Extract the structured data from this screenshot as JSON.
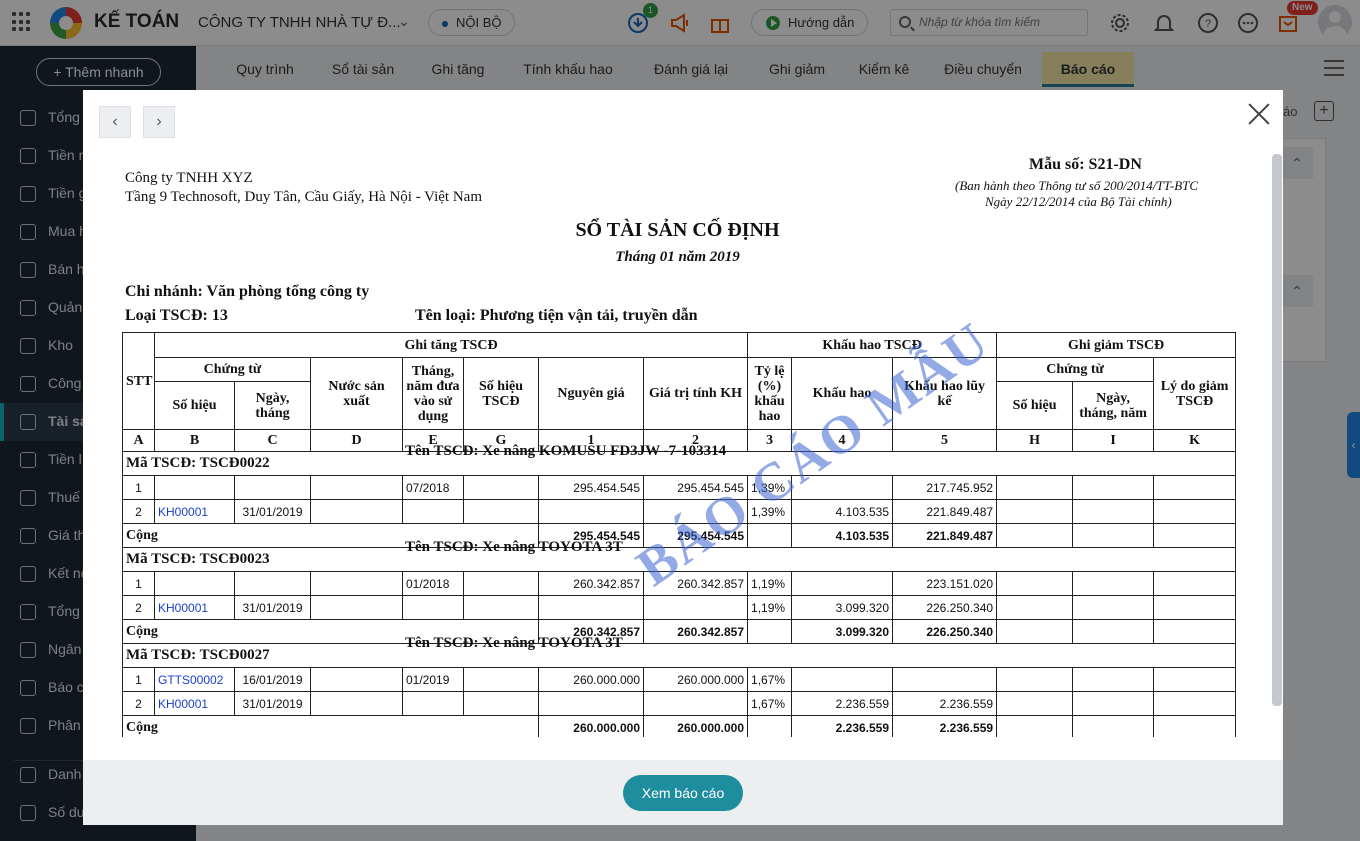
{
  "topbar": {
    "app_name": "KẾ TOÁN",
    "company": "CÔNG TY TNHH NHÀ TỰ Đ...",
    "scope": "NỘI BỘ",
    "download_badge": "1",
    "guide_label": "Hướng dẫn",
    "search_placeholder": "Nhập từ khóa tìm kiếm",
    "new_badge": "New"
  },
  "sidebar": {
    "add_button": "Thêm nhanh",
    "items": [
      {
        "label": "Tổng"
      },
      {
        "label": "Tiền m"
      },
      {
        "label": "Tiền g"
      },
      {
        "label": "Mua h"
      },
      {
        "label": "Bán h"
      },
      {
        "label": "Quản"
      },
      {
        "label": "Kho"
      },
      {
        "label": "Công"
      },
      {
        "label": "Tài sả"
      },
      {
        "label": "Tiền l"
      },
      {
        "label": "Thuế"
      },
      {
        "label": "Giá th"
      },
      {
        "label": "Kết nố"
      },
      {
        "label": "Tổng"
      },
      {
        "label": "Ngân"
      },
      {
        "label": "Báo c"
      },
      {
        "label": "Phân"
      },
      {
        "label": "Danh"
      },
      {
        "label": "Số dư"
      }
    ],
    "active_index": 8
  },
  "tabs": [
    {
      "label": "Quy trình"
    },
    {
      "label": "Sổ tài sản"
    },
    {
      "label": "Ghi tăng"
    },
    {
      "label": "Tính khấu hao"
    },
    {
      "label": "Đánh giá lại"
    },
    {
      "label": "Ghi giảm"
    },
    {
      "label": "Kiểm kê"
    },
    {
      "label": "Điều chuyển"
    },
    {
      "label": "Báo cáo"
    }
  ],
  "background": {
    "partial_text": "áo"
  },
  "report": {
    "company_name": "Công ty TNHH XYZ",
    "company_address": "Tầng 9 Technosoft, Duy Tân, Cầu Giấy, Hà Nội - Việt Nam",
    "form_no": "Mẫu số: S21-DN",
    "form_note_1": "(Ban hành theo Thông tư số 200/2014/TT-BTC",
    "form_note_2": "Ngày 22/12/2014 của Bộ Tài chính)",
    "title": "SỔ TÀI SẢN CỐ ĐỊNH",
    "period": "Tháng 01 năm 2019",
    "branch": "Chi nhánh: Văn phòng tổng công ty",
    "asset_type": "Loại TSCĐ: 13",
    "type_name": "Tên loại: Phương tiện vận tải, truyền dẫn",
    "watermark": "BÁO CÁO MẪU",
    "headers": {
      "stt": "STT",
      "increase": "Ghi tăng TSCĐ",
      "depreciation": "Khấu hao TSCĐ",
      "decrease": "Ghi giảm TSCĐ",
      "voucher": "Chứng từ",
      "voucher2": "Chứng từ",
      "voucher_no": "Số hiệu",
      "voucher_date": "Ngày, tháng",
      "country": "Nước sản xuất",
      "in_use": "Tháng, năm đưa vào sử dụng",
      "asset_no": "Số hiệu TSCĐ",
      "cost": "Nguyên giá",
      "depr_value": "Giá trị tính KH",
      "rate": "Tỷ lệ (%) khấu hao",
      "depr_amount": "Khấu hao",
      "accum_depr": "Khấu hao lũy kế",
      "dec_no": "Số hiệu",
      "dec_date": "Ngày, tháng, năm",
      "dec_reason": "Lý do giảm TSCĐ"
    },
    "letters": [
      "A",
      "B",
      "C",
      "D",
      "E",
      "G",
      "1",
      "2",
      "3",
      "4",
      "5",
      "H",
      "I",
      "K"
    ],
    "groups": [
      {
        "code": "Mã TSCĐ: TSCĐ0022",
        "name": "Tên TSCĐ: Xe nâng KOMUSU FD3JW -7-103314",
        "rows": [
          {
            "stt": "1",
            "voucher_no": "",
            "voucher_date": "",
            "in_use": "07/2018",
            "cost": "295.454.545",
            "depr_value": "295.454.545",
            "rate": "1,39%",
            "depr_amount": "",
            "accum": "217.745.952"
          },
          {
            "stt": "2",
            "voucher_no": "KH00001",
            "voucher_date": "31/01/2019",
            "in_use": "",
            "cost": "",
            "depr_value": "",
            "rate": "1,39%",
            "depr_amount": "4.103.535",
            "accum": "221.849.487"
          }
        ],
        "total": {
          "label": "Cộng",
          "cost": "295.454.545",
          "depr_value": "295.454.545",
          "depr_amount": "4.103.535",
          "accum": "221.849.487"
        }
      },
      {
        "code": "Mã TSCĐ: TSCĐ0023",
        "name": "Tên TSCĐ: Xe nâng TOYOTA 3T",
        "rows": [
          {
            "stt": "1",
            "voucher_no": "",
            "voucher_date": "",
            "in_use": "01/2018",
            "cost": "260.342.857",
            "depr_value": "260.342.857",
            "rate": "1,19%",
            "depr_amount": "",
            "accum": "223.151.020"
          },
          {
            "stt": "2",
            "voucher_no": "KH00001",
            "voucher_date": "31/01/2019",
            "in_use": "",
            "cost": "",
            "depr_value": "",
            "rate": "1,19%",
            "depr_amount": "3.099.320",
            "accum": "226.250.340"
          }
        ],
        "total": {
          "label": "Cộng",
          "cost": "260.342.857",
          "depr_value": "260.342.857",
          "depr_amount": "3.099.320",
          "accum": "226.250.340"
        }
      },
      {
        "code": "Mã TSCĐ: TSCĐ0027",
        "name": "Tên TSCĐ: Xe nâng TOYOTA 3T",
        "rows": [
          {
            "stt": "1",
            "voucher_no": "GTTS00002",
            "voucher_date": "16/01/2019",
            "in_use": "01/2019",
            "cost": "260.000.000",
            "depr_value": "260.000.000",
            "rate": "1,67%",
            "depr_amount": "",
            "accum": ""
          },
          {
            "stt": "2",
            "voucher_no": "KH00001",
            "voucher_date": "31/01/2019",
            "in_use": "",
            "cost": "",
            "depr_value": "",
            "rate": "1,67%",
            "depr_amount": "2.236.559",
            "accum": "2.236.559"
          }
        ],
        "total": {
          "label": "Cộng",
          "cost": "260.000.000",
          "depr_value": "260.000.000",
          "depr_amount": "2.236.559",
          "accum": "2.236.559"
        }
      }
    ]
  },
  "footer": {
    "view_button": "Xem báo cáo"
  },
  "colors": {
    "sidebar_bg": "#1d2a35",
    "accent": "#12b5c4",
    "primary_button": "#1e8e9e",
    "active_tab_bg": "#f6e7a8",
    "link": "#1a3fd0",
    "watermark": "#3c64d2"
  }
}
